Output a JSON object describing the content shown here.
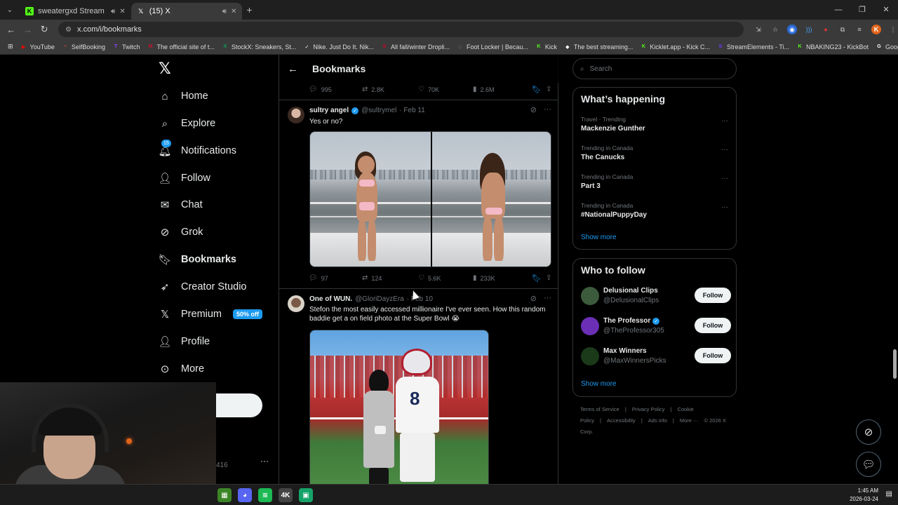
{
  "browser": {
    "tabs": [
      {
        "title": "sweatergxd Stream - Watch",
        "favicon": "kick-icon",
        "color": "#53fc18",
        "active": false
      },
      {
        "title": "(15) X",
        "favicon": "x-icon",
        "color": "#ffffff",
        "active": true
      }
    ],
    "url": "x.com/i/bookmarks",
    "profile_initial": "K",
    "bookmarks": [
      {
        "label": "YouTube",
        "color": "#ff0000",
        "glyph": "▶"
      },
      {
        "label": "SelfBooking",
        "color": "#e14b3b",
        "glyph": "~"
      },
      {
        "label": "Twitch",
        "color": "#9146ff",
        "glyph": "T"
      },
      {
        "label": "The official site of t...",
        "color": "#c8102e",
        "glyph": "M"
      },
      {
        "label": "StockX: Sneakers, St...",
        "color": "#08a05c",
        "glyph": "X"
      },
      {
        "label": "Nike. Just Do It. Nik...",
        "color": "#ffffff",
        "glyph": "✓"
      },
      {
        "label": "All fall/winter Dropli...",
        "color": "#d4002a",
        "glyph": "S"
      },
      {
        "label": "Foot Locker | Becau...",
        "color": "#777777",
        "glyph": "◇"
      },
      {
        "label": "Kick",
        "color": "#53fc18",
        "glyph": "K"
      },
      {
        "label": "The best streaming...",
        "color": "#ffffff",
        "glyph": "◆"
      },
      {
        "label": "Kicklet.app - Kick C...",
        "color": "#53fc18",
        "glyph": "K"
      },
      {
        "label": "StreamElements - Ti...",
        "color": "#6d3bff",
        "glyph": "S"
      },
      {
        "label": "NBAKING23 - KickBot",
        "color": "#53fc18",
        "glyph": "K"
      },
      {
        "label": "Google",
        "color": "#ffffff",
        "glyph": "G"
      }
    ]
  },
  "nav": {
    "items": [
      {
        "label": "Home",
        "icon": "home-icon",
        "glyph": "⌂"
      },
      {
        "label": "Explore",
        "icon": "search-icon",
        "glyph": "⌕"
      },
      {
        "label": "Notifications",
        "icon": "bell-icon",
        "glyph": "🔔︎",
        "badge": "15"
      },
      {
        "label": "Follow",
        "icon": "add-person-icon",
        "glyph": "👤︎"
      },
      {
        "label": "Chat",
        "icon": "mail-icon",
        "glyph": "✉"
      },
      {
        "label": "Grok",
        "icon": "grok-icon",
        "glyph": "⊘"
      },
      {
        "label": "Bookmarks",
        "icon": "bookmark-icon",
        "glyph": "🔖︎",
        "active": true
      },
      {
        "label": "Creator Studio",
        "icon": "rocket-icon",
        "glyph": "➶"
      },
      {
        "label": "Premium",
        "icon": "x-premium-icon",
        "glyph": "𝕏",
        "promo": "50% off"
      },
      {
        "label": "Profile",
        "icon": "person-icon",
        "glyph": "👤︎"
      },
      {
        "label": "More",
        "icon": "more-circle-icon",
        "glyph": "⊙"
      }
    ],
    "account_handle_fragment": "416"
  },
  "header": {
    "title": "Bookmarks"
  },
  "top_actions": {
    "replies": "995",
    "reposts": "2.8K",
    "likes": "70K",
    "views": "2.6M"
  },
  "tweets": [
    {
      "name": "sultry angel",
      "handle": "@sultrymel",
      "date": "· Feb 11",
      "verified": true,
      "text": "Yes or no?",
      "replies": "97",
      "reposts": "124",
      "likes": "5.6K",
      "views": "233K"
    },
    {
      "name": "One of WUN.",
      "handle": "@GloriDayzEra",
      "date": "· Feb 10",
      "verified": false,
      "text": "Stefon the most easily accessed millionaire I've ever seen. How this random baddie get a on field photo at the Super Bowl 😭",
      "jersey_number": "8"
    }
  ],
  "sidebar": {
    "search_placeholder": "Search",
    "trends_title": "What’s happening",
    "trends": [
      {
        "meta": "Travel · Trending",
        "name": "Mackenzie Gunther"
      },
      {
        "meta": "Trending in Canada",
        "name": "The Canucks"
      },
      {
        "meta": "Trending in Canada",
        "name": "Part 3"
      },
      {
        "meta": "Trending in Canada",
        "name": "#NationalPuppyDay"
      }
    ],
    "show_more": "Show more",
    "wtf_title": "Who to follow",
    "wtf": [
      {
        "name": "Delusional Clips",
        "handle": "@DelusionalClips",
        "verified": false,
        "av_color": "#3c5a3c"
      },
      {
        "name": "The Professor",
        "handle": "@TheProfessor305",
        "verified": true,
        "av_color": "#6a2fb5"
      },
      {
        "name": "Max Winners",
        "handle": "@MaxWinnersPicks",
        "verified": false,
        "av_color": "#1a3a1a"
      }
    ],
    "follow_label": "Follow",
    "footer": [
      "Terms of Service",
      "|",
      "Privacy Policy",
      "|",
      "Cookie Policy",
      "|",
      "Accessibility",
      "|",
      "Ads info",
      "|",
      "More ···",
      "© 2026 X Corp."
    ]
  },
  "taskbar": {
    "time": "1:45 AM",
    "date": "2026-03-24",
    "apps": [
      {
        "name": "minecraft-icon",
        "color": "#3c8527",
        "glyph": "▦"
      },
      {
        "name": "discord-icon",
        "color": "#5865f2",
        "glyph": "◕"
      },
      {
        "name": "spotify-icon",
        "color": "#1db954",
        "glyph": "≋"
      },
      {
        "name": "4k-video-icon",
        "color": "#444444",
        "glyph": "4K"
      },
      {
        "name": "chat-app-icon",
        "color": "#16a36a",
        "glyph": "▣"
      }
    ]
  }
}
